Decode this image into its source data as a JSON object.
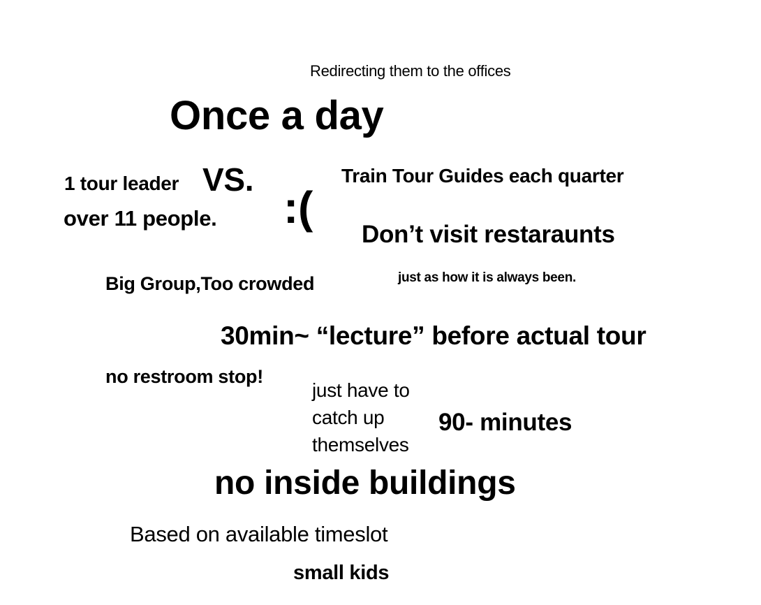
{
  "notes": {
    "redirecting": "Redirecting them to the offices",
    "once_a_day": "Once a day",
    "tour_leader": "1 tour leader",
    "vs": "VS.",
    "over_people": "over 11 people.",
    "sad_face": ":(",
    "train_guides": "Train Tour Guides each quarter",
    "restaurants": "Don’t visit restaraunts",
    "big_group": "Big Group,Too crowded",
    "always_been": "just as how it is always been.",
    "lecture": "30min~ “lecture” before actual tour",
    "restroom": "no restroom stop!",
    "catch_up": [
      "just have to",
      "catch up",
      "themselves"
    ],
    "ninety": "90- minutes",
    "no_inside": "no inside buildings",
    "timeslot": "Based on available timeslot",
    "small_kids": "small kids"
  }
}
